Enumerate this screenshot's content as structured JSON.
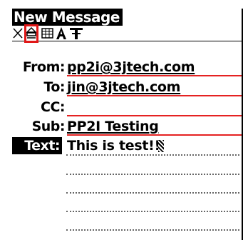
{
  "window": {
    "title": "New Message"
  },
  "toolbar": {
    "icons": [
      "close-icon",
      "send-icon",
      "grid-icon",
      "font-icon",
      "text-size-icon"
    ],
    "highlight_color": "#e01818"
  },
  "fields": {
    "from": {
      "label": "From:",
      "value": "pp2i@3jtech.com"
    },
    "to": {
      "label": "To:",
      "value": "jin@3jtech.com"
    },
    "cc": {
      "label": "CC:",
      "value": ""
    },
    "sub": {
      "label": "Sub:",
      "value": "PP2I Testing"
    }
  },
  "body": {
    "label": "Text:",
    "value": "This is test!!"
  },
  "colors": {
    "field_line": "#e52222",
    "accent": "#e01818"
  }
}
